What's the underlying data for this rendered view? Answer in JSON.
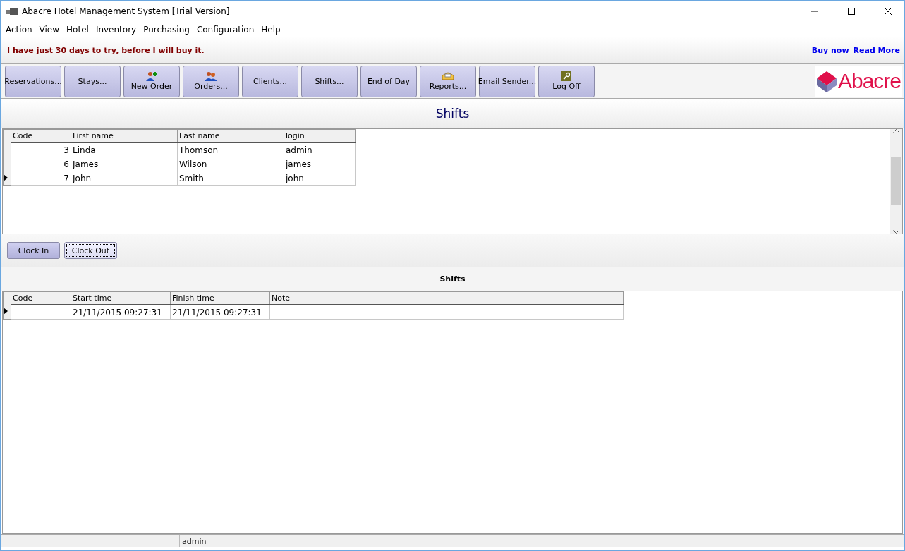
{
  "window": {
    "title": "Abacre Hotel Management System [Trial Version]"
  },
  "menu": [
    "Action",
    "View",
    "Hotel",
    "Inventory",
    "Purchasing",
    "Configuration",
    "Help"
  ],
  "trial": {
    "message": "I have just 30 days to try, before I will buy it.",
    "links": [
      "Buy now",
      "Read More"
    ]
  },
  "toolbar": [
    {
      "label": "Reservations...",
      "kind": "plain"
    },
    {
      "label": "Stays...",
      "kind": "plain"
    },
    {
      "label": "New Order",
      "kind": "add-person"
    },
    {
      "label": "Orders...",
      "kind": "people"
    },
    {
      "label": "Clients...",
      "kind": "plain"
    },
    {
      "label": "Shifts...",
      "kind": "plain"
    },
    {
      "label": "End of Day",
      "kind": "plain"
    },
    {
      "label": "Reports...",
      "kind": "tray"
    },
    {
      "label": "Email Sender...",
      "kind": "plain"
    },
    {
      "label": "Log Off",
      "kind": "key"
    }
  ],
  "logo": {
    "text": "Abacre"
  },
  "page_title": "Shifts",
  "employees": {
    "columns": [
      "Code",
      "First name",
      "Last name",
      "login"
    ],
    "rows": [
      {
        "cells": [
          "3",
          "Linda",
          "Thomson",
          "admin"
        ],
        "selected": false
      },
      {
        "cells": [
          "6",
          "James",
          "Wilson",
          "james"
        ],
        "selected": false
      },
      {
        "cells": [
          "7",
          "John",
          "Smith",
          "john"
        ],
        "selected": true
      }
    ]
  },
  "actions": [
    {
      "label": "Clock In",
      "focused": false
    },
    {
      "label": "Clock Out",
      "focused": true
    }
  ],
  "shifts": {
    "title": "Shifts",
    "columns": [
      "Code",
      "Start time",
      "Finish time",
      "Note"
    ],
    "rows": [
      {
        "cells": [
          "",
          "21/11/2015 09:27:31",
          "21/11/2015 09:27:31",
          ""
        ],
        "selected": true
      }
    ]
  },
  "status_bar": {
    "user": "admin"
  }
}
